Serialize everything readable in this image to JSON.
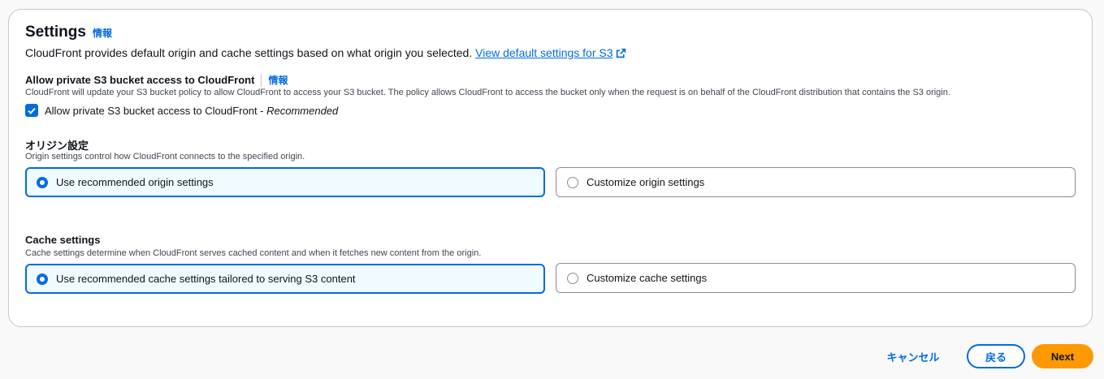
{
  "settings": {
    "title": "Settings",
    "info": "情報",
    "description": "CloudFront provides default origin and cache settings based on what origin you selected.",
    "default_link": "View default settings for S3"
  },
  "private_access": {
    "label": "Allow private S3 bucket access to CloudFront",
    "info": "情報",
    "description": "CloudFront will update your S3 bucket policy to allow CloudFront to access your S3 bucket. The policy allows CloudFront to access the bucket only when the request is on behalf of the CloudFront distribution that contains the S3 origin.",
    "checkbox_label": "Allow private S3 bucket access to CloudFront - ",
    "checkbox_emphasis": "Recommended",
    "checked": true
  },
  "origin": {
    "label": "オリジン設定",
    "description": "Origin settings control how CloudFront connects to the specified origin.",
    "options": [
      {
        "label": "Use recommended origin settings",
        "selected": true
      },
      {
        "label": "Customize origin settings",
        "selected": false
      }
    ]
  },
  "cache": {
    "label": "Cache settings",
    "description": "Cache settings determine when CloudFront serves cached content and when it fetches new content from the origin.",
    "options": [
      {
        "label": "Use recommended cache settings tailored to serving S3 content",
        "selected": true
      },
      {
        "label": "Customize cache settings",
        "selected": false
      }
    ]
  },
  "footer": {
    "cancel": "キャンセル",
    "back": "戻る",
    "next": "Next"
  },
  "colors": {
    "accent": "#006ce0",
    "primary_button": "#ff9900",
    "selected_tile_bg": "#f0fbff"
  }
}
